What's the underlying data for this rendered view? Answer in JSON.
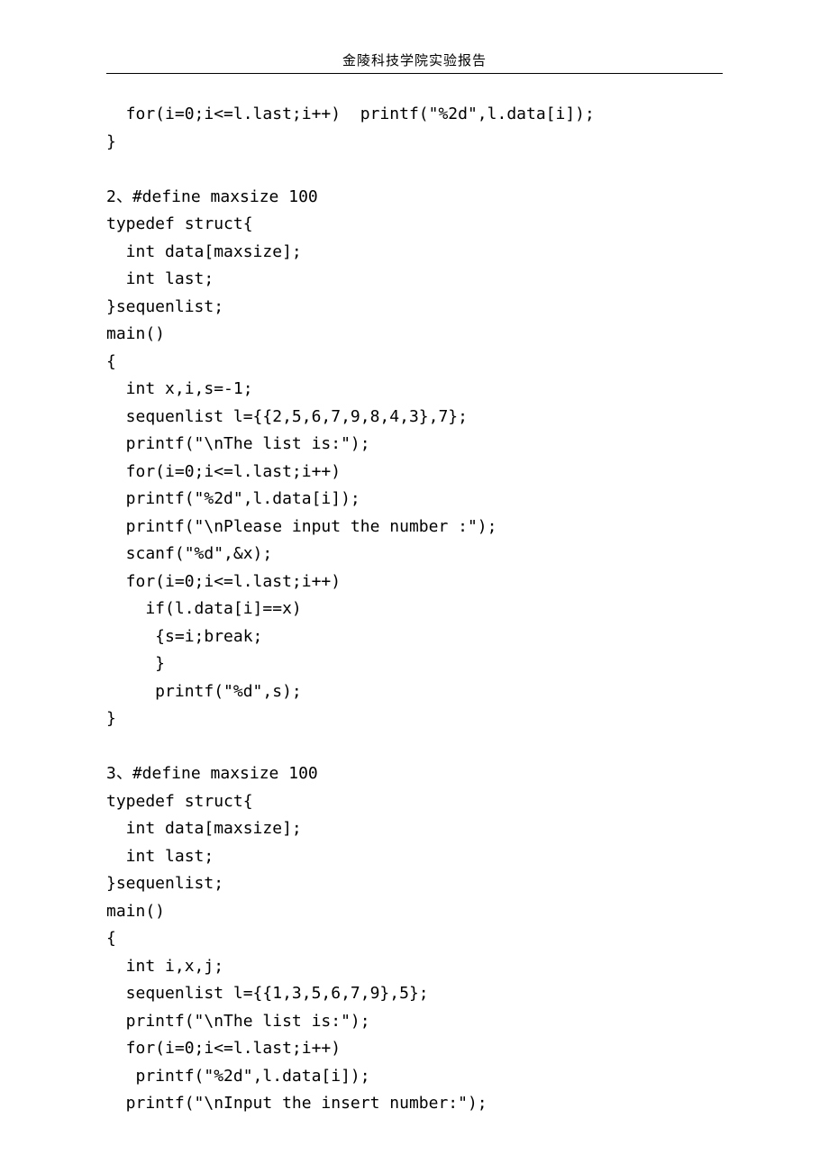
{
  "header": "金陵科技学院实验报告",
  "lines": [
    "  for(i=0;i<=l.last;i++)  printf(\"%2d\",l.data[i]);",
    "}",
    "",
    "2、#define maxsize 100",
    "typedef struct{",
    "  int data[maxsize];",
    "  int last;",
    "}sequenlist;",
    "main()",
    "{",
    "  int x,i,s=-1;",
    "  sequenlist l={{2,5,6,7,9,8,4,3},7};",
    "  printf(\"\\nThe list is:\");",
    "  for(i=0;i<=l.last;i++)",
    "  printf(\"%2d\",l.data[i]);",
    "  printf(\"\\nPlease input the number :\");",
    "  scanf(\"%d\",&x);",
    "  for(i=0;i<=l.last;i++)",
    "    if(l.data[i]==x)",
    "     {s=i;break;",
    "     }",
    "     printf(\"%d\",s);",
    "}",
    "",
    "3、#define maxsize 100",
    "typedef struct{",
    "  int data[maxsize];",
    "  int last;",
    "}sequenlist;",
    "main()",
    "{",
    "  int i,x,j;",
    "  sequenlist l={{1,3,5,6,7,9},5};",
    "  printf(\"\\nThe list is:\");",
    "  for(i=0;i<=l.last;i++)",
    "   printf(\"%2d\",l.data[i]);",
    "  printf(\"\\nInput the insert number:\");"
  ]
}
